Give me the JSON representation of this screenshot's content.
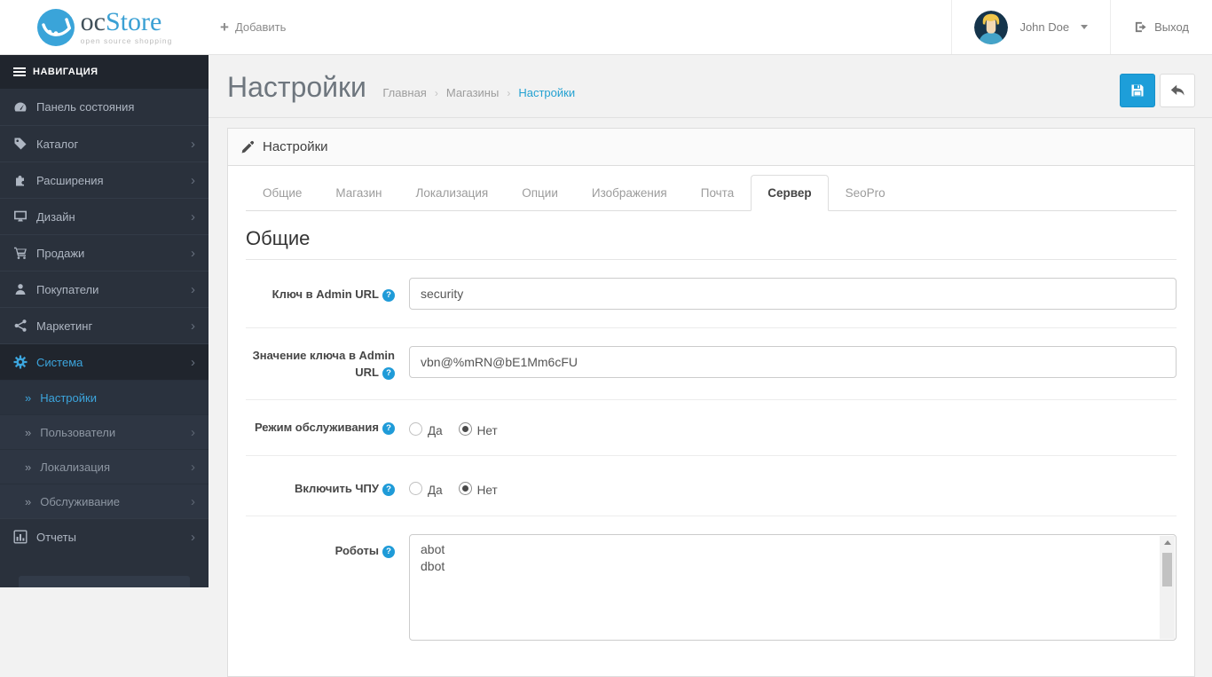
{
  "header": {
    "logo_oc": "oc",
    "logo_store": "Store",
    "logo_tagline": "open source shopping",
    "add_label": "Добавить",
    "user_name": "John Doe",
    "logout_label": "Выход"
  },
  "icons": {
    "chevron_right": "›",
    "subitem_marker": "»",
    "breadcrumb_sep": "›",
    "help": "?",
    "plus": "+"
  },
  "sidebar": {
    "nav_title": "НАВИГАЦИЯ",
    "items": [
      {
        "label": "Панель состояния"
      },
      {
        "label": "Каталог"
      },
      {
        "label": "Расширения"
      },
      {
        "label": "Дизайн"
      },
      {
        "label": "Продажи"
      },
      {
        "label": "Покупатели"
      },
      {
        "label": "Маркетинг"
      },
      {
        "label": "Система"
      },
      {
        "label": "Отчеты"
      }
    ],
    "system_subitems": [
      {
        "label": "Настройки"
      },
      {
        "label": "Пользователи"
      },
      {
        "label": "Локализация"
      },
      {
        "label": "Обслуживание"
      }
    ]
  },
  "page": {
    "title": "Настройки",
    "breadcrumb": [
      {
        "label": "Главная"
      },
      {
        "label": "Магазины"
      },
      {
        "label": "Настройки"
      }
    ]
  },
  "panel": {
    "heading": "Настройки",
    "tabs": [
      {
        "label": "Общие"
      },
      {
        "label": "Магазин"
      },
      {
        "label": "Локализация"
      },
      {
        "label": "Опции"
      },
      {
        "label": "Изображения"
      },
      {
        "label": "Почта"
      },
      {
        "label": "Сервер"
      },
      {
        "label": "SeoPro"
      }
    ],
    "active_tab": "Сервер",
    "section_title": "Общие"
  },
  "form": {
    "admin_key": {
      "label": "Ключ в Admin URL",
      "value": "security"
    },
    "admin_key_value": {
      "label": "Значение ключа в Admin URL",
      "value": "vbn@%mRN@bE1Mm6cFU"
    },
    "maintenance": {
      "label": "Режим обслуживания",
      "option_yes": "Да",
      "option_no": "Нет",
      "selected": "Нет"
    },
    "seo_url": {
      "label": "Включить ЧПУ",
      "option_yes": "Да",
      "option_no": "Нет",
      "selected": "Нет"
    },
    "robots": {
      "label": "Роботы",
      "value": "abot\ndbot"
    }
  },
  "colors": {
    "accent": "#23a1d1",
    "save_button": "#1d9ed9",
    "sidebar_bg": "#2a313c",
    "sidebar_active": "#3ca5dd"
  }
}
